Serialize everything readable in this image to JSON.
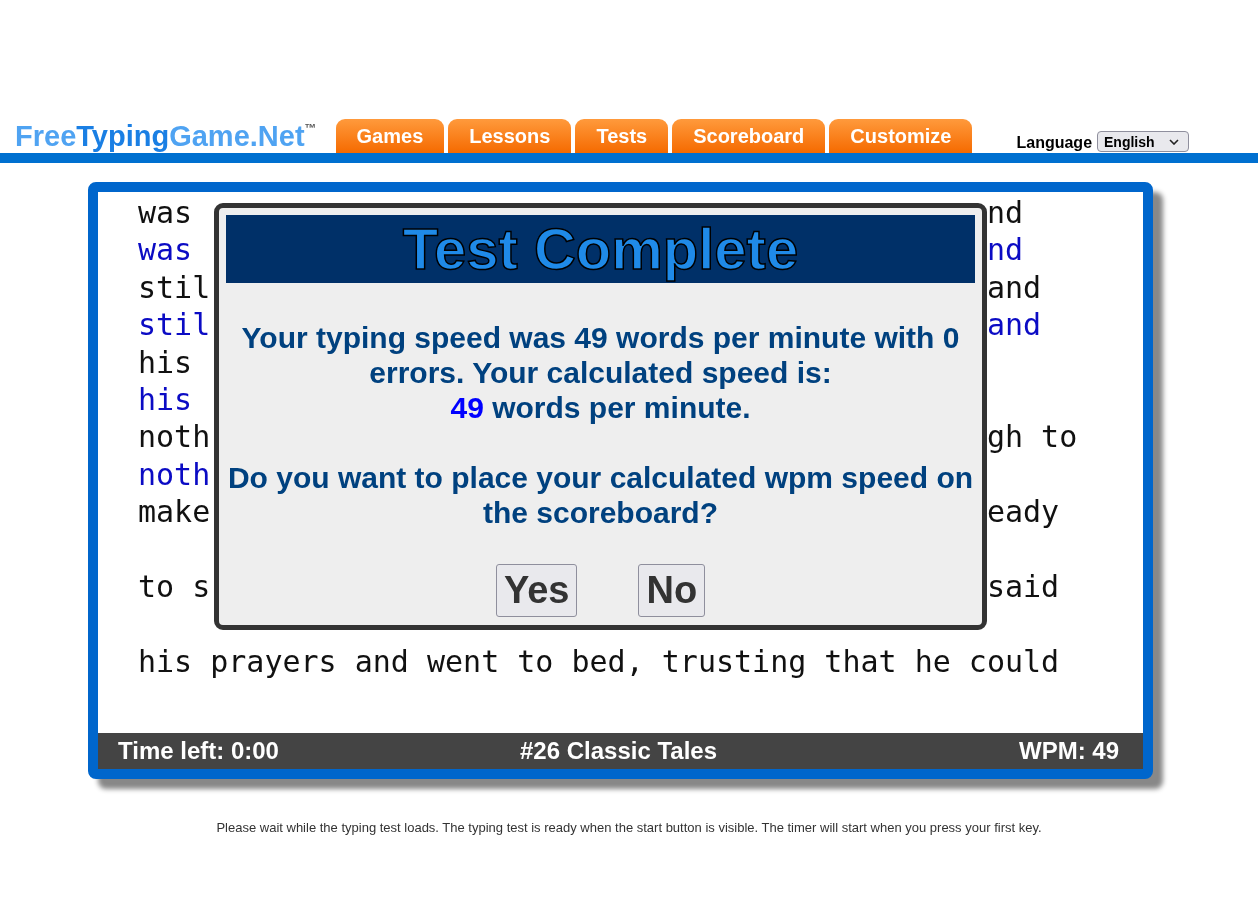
{
  "header": {
    "logo": {
      "segments": [
        "Free",
        "Typing",
        "Game.Net"
      ],
      "trademark": "™"
    },
    "tabs": [
      {
        "label": "Games",
        "selected": false
      },
      {
        "label": "Lessons",
        "selected": false
      },
      {
        "label": "Tests",
        "selected": false
      },
      {
        "label": "Scoreboard",
        "selected": false
      },
      {
        "label": "Customize",
        "selected": false
      }
    ],
    "language": {
      "label": "Language",
      "value": "English"
    }
  },
  "passage": [
    {
      "source": {
        "left": "was",
        "right": "nd"
      },
      "typed": {
        "left": "was",
        "right": "nd"
      }
    },
    {
      "source": {
        "left": "stil",
        "right": "and"
      },
      "typed": {
        "left": "stil",
        "right": "and"
      }
    },
    {
      "source": {
        "left": "his"
      },
      "typed": {
        "left": "his"
      }
    },
    {
      "source": {
        "left": "noth",
        "right": "gh to"
      },
      "typed": {
        "left": "noth"
      }
    },
    {
      "source": {
        "left": "make",
        "right": "eady"
      }
    },
    {
      "source": {
        "left": "to s",
        "right": "said"
      }
    },
    {
      "source": {
        "text": "his prayers and went to bed, trusting that he could"
      }
    }
  ],
  "status_bar": {
    "time_left": "Time left: 0:00",
    "test_name": "#26 Classic Tales",
    "wpm": "WPM: 49"
  },
  "dialog": {
    "title": "Test Complete",
    "message": "Your typing speed was 49 words per minute with 0 errors. Your calculated speed is:",
    "result": {
      "value": "49",
      "unit": "words per minute."
    },
    "question": "Do you want to place your calculated wpm speed on the scoreboard?",
    "buttons": [
      "Yes",
      "No"
    ]
  },
  "footer_note": "Please wait while the typing test loads. The typing test is ready when the start button is visible. The timer will start when you press your first key."
}
